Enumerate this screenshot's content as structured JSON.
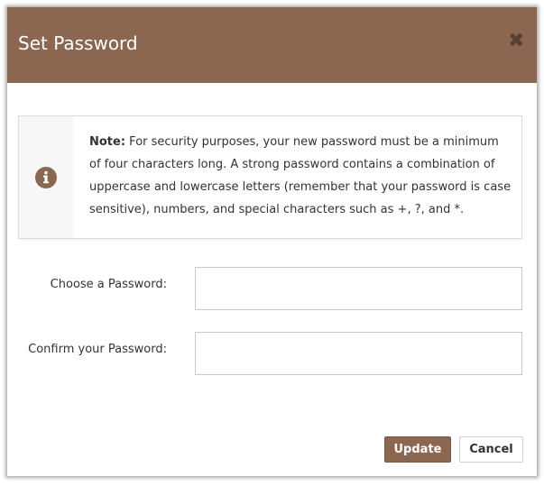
{
  "dialog": {
    "title": "Set Password",
    "close_icon": "close-icon"
  },
  "note": {
    "icon": "info-icon",
    "lead": "Note:",
    "body": " For security purposes, your new password must be a minimum of four characters long. A strong password contains a combination of uppercase and lowercase letters (remember that your password is case sensitive), numbers, and special characters such as +, ?, and *."
  },
  "form": {
    "password_label": "Choose a Password:",
    "password_value": "",
    "confirm_label": "Confirm your Password:",
    "confirm_value": ""
  },
  "buttons": {
    "update_label": "Update",
    "cancel_label": "Cancel"
  },
  "colors": {
    "accent": "#8b6651"
  }
}
